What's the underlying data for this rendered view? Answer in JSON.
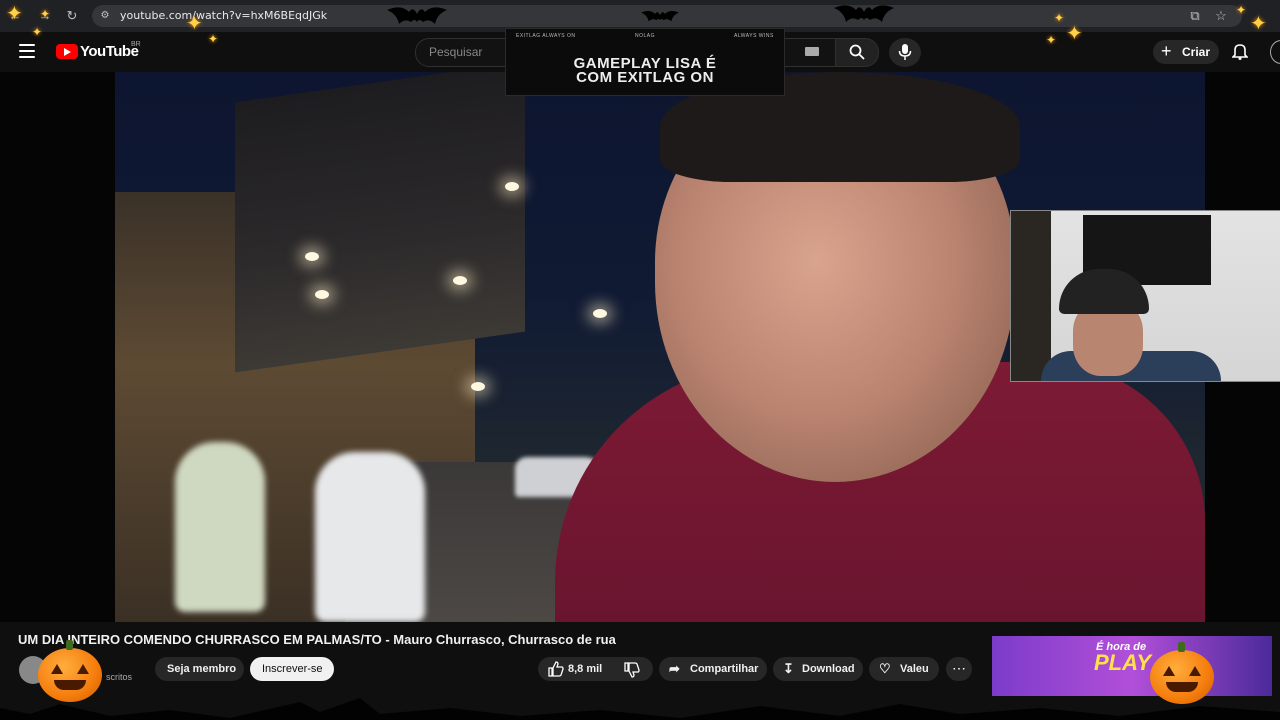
{
  "browser": {
    "url": "youtube.com/watch?v=hxM6BEqdJGk"
  },
  "header": {
    "logo_text": "YouTube",
    "region": "BR",
    "search_placeholder": "Pesquisar",
    "create_label": "Criar"
  },
  "overlay_ad": {
    "small_left": "EXITLAG ALWAYS ON",
    "small_mid": "NOLAG",
    "small_right": "ALWAYS WINS",
    "line1": "GAMEPLAY LISA É",
    "line2": "COM EXITLAG ON"
  },
  "video": {
    "title": "UM DIA INTEIRO COMENDO CHURRASCO EM PALMAS/TO - Mauro Churrasco, Churrasco de rua",
    "subscribers": "scritos"
  },
  "actions": {
    "member": "Seja membro",
    "subscribe": "Inscrever-se",
    "likes": "8,8 mil",
    "share": "Compartilhar",
    "download": "Download",
    "thanks": "Valeu"
  },
  "side_ad": {
    "line1": "É hora de",
    "line2": "PLAY"
  },
  "colors": {
    "brand": "#ff0000",
    "shirt": "#7d1a34",
    "pumpkin": "#f57d0d"
  }
}
